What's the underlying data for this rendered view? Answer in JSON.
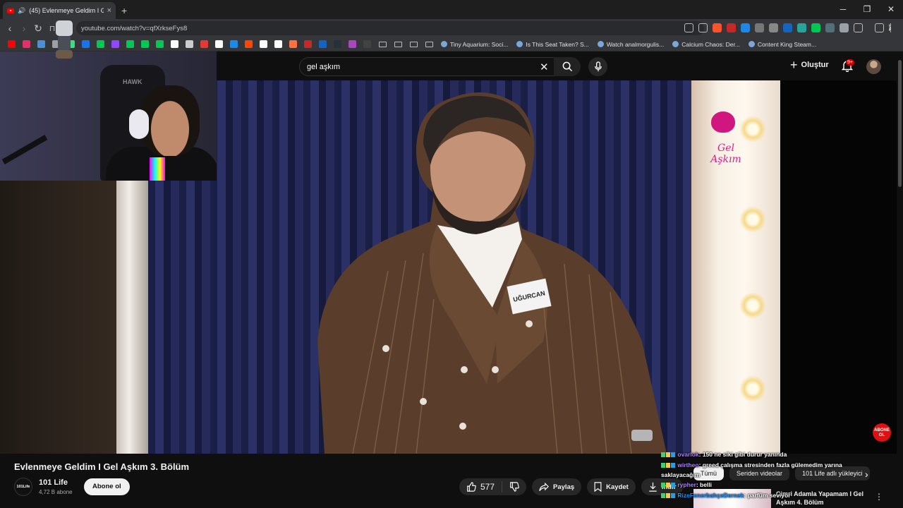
{
  "browser": {
    "tab_title": "(45) Evlenmeye Geldim I Gel A",
    "tab_close": "×",
    "new_tab": "+",
    "url": "youtube.com/watch?v=qfXrkseFys8",
    "window_controls": [
      "─",
      "❐",
      "✕"
    ],
    "bookmark_links": [
      "Tiny Aquarium: Soci...",
      "Is This Seat Taken? S...",
      "Watch analmorgulis...",
      "Calcium Chaos: Der...",
      "Content King Steam..."
    ],
    "bookmark_icon_colors": [
      "#ff0000",
      "#e1306c",
      "#4a90d9",
      "#9aa0a6",
      "#3ddc84",
      "#1a73e8",
      "#00c853",
      "#9147ff",
      "#00c853",
      "#00c853",
      "#00c853",
      "#ffffff",
      "#cccccc",
      "#e53935",
      "#ffffff",
      "#1e88e5",
      "#ff4500",
      "#ffffff",
      "#ffffff",
      "#ff7043",
      "#c62828",
      "#1565c0",
      "#263238",
      "#ab47bc",
      "#424242"
    ]
  },
  "youtube": {
    "search_value": "gel aşkım",
    "create_label": "Oluştur",
    "notification_count": "9+",
    "video_title": "Evlenmeye Geldim I Gel Aşkım 3. Bölüm",
    "channel_logo_text": "101Life",
    "channel_name": "101 Life",
    "subscriber_count": "4,72 B abone",
    "subscribe_label": "Abone ol",
    "like_count": "577",
    "share_label": "Paylaş",
    "save_label": "Kaydet",
    "download_label": "İndir",
    "chips": [
      "Tümü",
      "Seriden videolar",
      "101 Life adlı yükleyici"
    ],
    "related_title": "Cimri Adamla Yapamam I Gel Aşkım 4. Bölüm"
  },
  "video_overlay": {
    "name_card": "UĞURCAN",
    "brand_logo": "Gel Aşkım",
    "subscribe_overlay": "ABONE OL",
    "chair_logo": "HAWK"
  },
  "chat": [
    {
      "user": "ovarlok",
      "message": ": 150 ne siki gibi durur yanında",
      "color": "#b07cff"
    },
    {
      "user": "wirtheo",
      "message": ": greed çalışma stresinden fazla gülemedim yarına saklayacağım",
      "color": "#b07cff"
    },
    {
      "user": "rypher",
      "message": ": belli",
      "color": "#b07cff"
    },
    {
      "user": "RizeFenerbahçeDernek",
      "message": ": parfüm seviyor",
      "color": "#1e90ff"
    }
  ]
}
